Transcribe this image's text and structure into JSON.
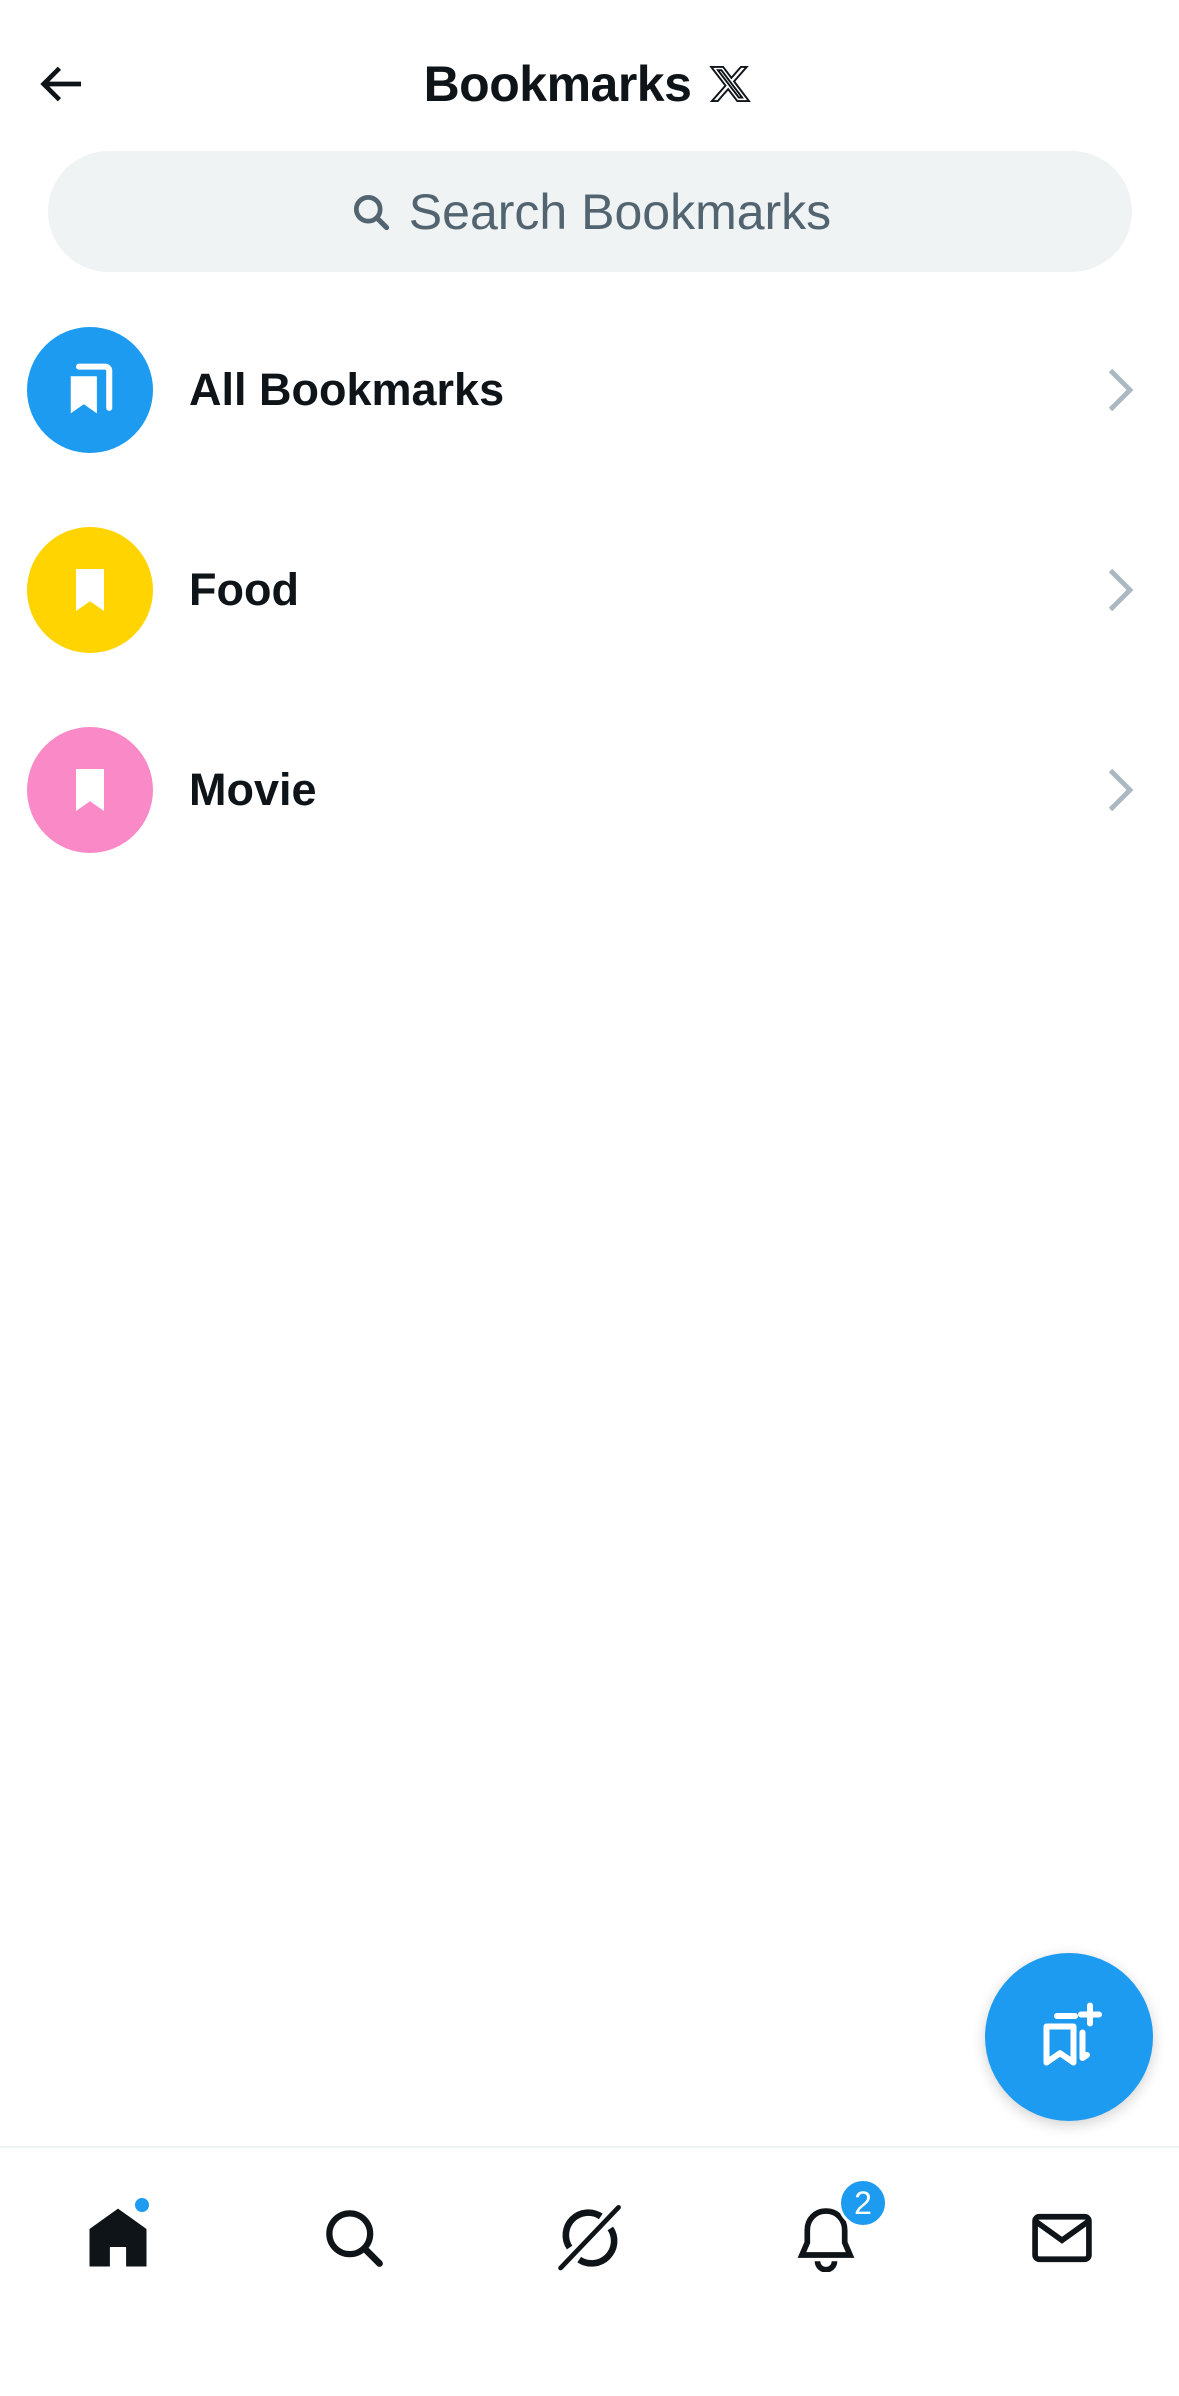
{
  "header": {
    "title": "Bookmarks",
    "back_icon": "arrow-left-icon",
    "logo_icon": "x-logo-icon"
  },
  "search": {
    "placeholder": "Search Bookmarks",
    "icon": "search-icon"
  },
  "folders": [
    {
      "label": "All Bookmarks",
      "color": "#1d9bf0",
      "icon": "bookmark-stack-icon"
    },
    {
      "label": "Food",
      "color": "#ffd400",
      "icon": "bookmark-icon"
    },
    {
      "label": "Movie",
      "color": "#f98ac7",
      "icon": "bookmark-icon"
    }
  ],
  "fab": {
    "icon": "add-bookmark-folder-icon",
    "color": "#1d9bf0"
  },
  "nav": {
    "items": [
      {
        "name": "home",
        "icon": "home-icon",
        "has_dot": true
      },
      {
        "name": "explore",
        "icon": "search-icon"
      },
      {
        "name": "grok",
        "icon": "grok-icon"
      },
      {
        "name": "notifications",
        "icon": "bell-icon",
        "badge": "2"
      },
      {
        "name": "messages",
        "icon": "mail-icon"
      }
    ]
  },
  "colors": {
    "accent": "#1d9bf0",
    "text_primary": "#0f1419",
    "text_secondary": "#536471",
    "search_bg": "#eff3f4"
  }
}
